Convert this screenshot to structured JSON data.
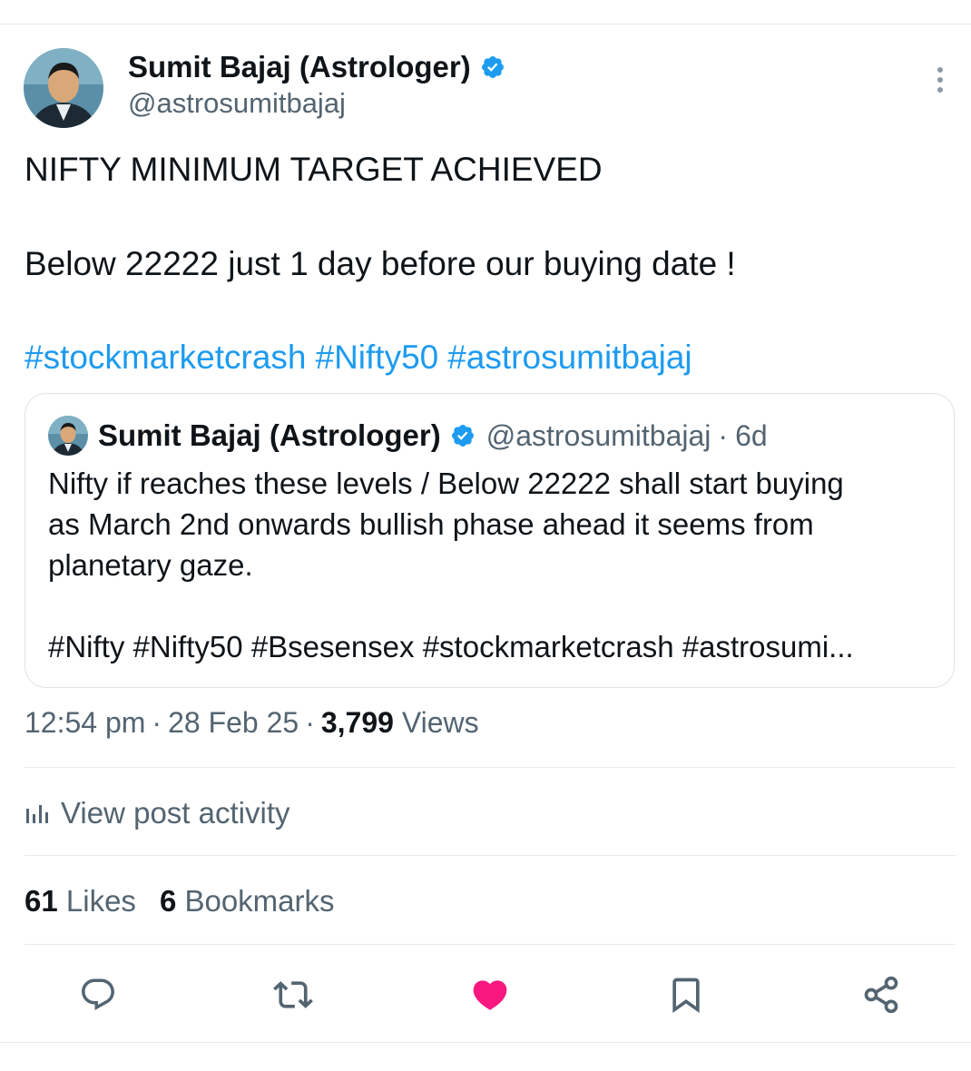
{
  "tweet": {
    "author_name": "Sumit Bajaj (Astrologer)",
    "author_handle": "@astrosumitbajaj",
    "line1": "NIFTY MINIMUM TARGET ACHIEVED",
    "line2": "Below 22222 just 1 day before our buying date !",
    "hashtags": [
      "#stockmarketcrash",
      "#Nifty50",
      "#astrosumitbajaj"
    ]
  },
  "quoted": {
    "author_name": "Sumit Bajaj (Astrologer)",
    "author_handle": "@astrosumitbajaj",
    "separator": "·",
    "time": "6d",
    "lines": [
      "Nifty if reaches these levels / Below 22222 shall start buying",
      "as March 2nd onwards bullish phase ahead it seems from",
      "planetary gaze."
    ],
    "hashtag_line": "#Nifty #Nifty50 #Bsesensex #stockmarketcrash #astrosumi..."
  },
  "meta": {
    "time": "12:54 pm",
    "separator": "·",
    "date": "28 Feb 25",
    "views_count": "3,799",
    "views_label": "Views"
  },
  "activity_label": "View post activity",
  "stats": {
    "likes_count": "61",
    "likes_label": "Likes",
    "bookmarks_count": "6",
    "bookmarks_label": "Bookmarks"
  },
  "colors": {
    "link": "#1d9bf0",
    "muted": "#536471",
    "text": "#0f1419",
    "like_active": "#f91880",
    "verified": "#1d9bf0"
  },
  "icons": [
    "verified-badge-icon",
    "more-icon",
    "analytics-icon",
    "reply-icon",
    "retweet-icon",
    "like-icon",
    "bookmark-icon",
    "share-icon"
  ]
}
